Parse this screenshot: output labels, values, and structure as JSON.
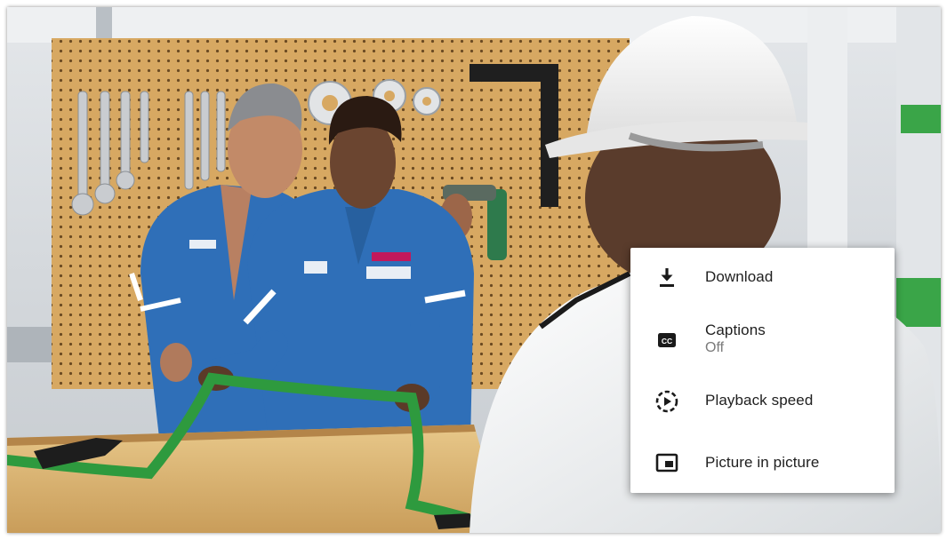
{
  "menu": {
    "items": [
      {
        "icon": "download-icon",
        "label": "Download"
      },
      {
        "icon": "captions-icon",
        "label": "Captions",
        "value": "Off",
        "badge": "CC"
      },
      {
        "icon": "playback-speed-icon",
        "label": "Playback speed"
      },
      {
        "icon": "picture-in-picture-icon",
        "label": "Picture in picture"
      }
    ]
  },
  "colors": {
    "menu_bg": "#ffffff",
    "text": "#202020",
    "subtext": "#7a7a7a",
    "uniform_blue": "#2f6fb8",
    "pegboard": "#d7a862",
    "strap_green": "#2e9a3e"
  }
}
